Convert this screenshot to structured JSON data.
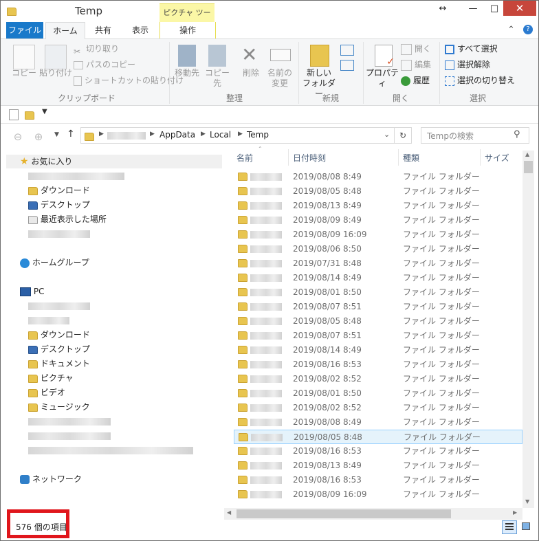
{
  "window": {
    "title": "Temp",
    "context_tab_group": "ピクチャ ツール",
    "controls": {
      "minimize": "—",
      "maximize": "□",
      "close": "✕",
      "resize": "↔"
    }
  },
  "ribbon_tabs": {
    "file": "ファイル",
    "home": "ホーム",
    "share": "共有",
    "view": "表示",
    "manage": "操作"
  },
  "ribbon": {
    "clipboard": {
      "label": "クリップボード",
      "copy": "コピー",
      "paste": "貼り付け",
      "cut": "切り取り",
      "copy_path": "パスのコピー",
      "paste_shortcut": "ショートカットの貼り付け"
    },
    "organize": {
      "label": "整理",
      "move_to": "移動先",
      "copy_to": "コピー先",
      "delete": "削除",
      "rename_1": "名前の",
      "rename_2": "変更"
    },
    "new": {
      "label": "新規",
      "new_folder_1": "新しい",
      "new_folder_2": "フォルダー"
    },
    "open": {
      "label": "開く",
      "properties": "プロパティ",
      "open": "開く",
      "edit": "編集",
      "history": "履歴"
    },
    "select": {
      "label": "選択",
      "select_all": "すべて選択",
      "select_none": "選択解除",
      "invert": "選択の切り替え"
    }
  },
  "address": {
    "path": [
      "AppData",
      "Local",
      "Temp"
    ],
    "search_placeholder": "Tempの検索"
  },
  "nav": {
    "favorites": "お気に入り",
    "downloads": "ダウンロード",
    "desktop": "デスクトップ",
    "recent": "最近表示した場所",
    "homegroup": "ホームグループ",
    "pc": "PC",
    "pc_downloads": "ダウンロード",
    "pc_desktop": "デスクトップ",
    "documents": "ドキュメント",
    "pictures": "ピクチャ",
    "videos": "ビデオ",
    "music": "ミュージック",
    "network": "ネットワーク"
  },
  "columns": {
    "name": "名前",
    "date": "日付時刻",
    "type": "種類",
    "size": "サイズ"
  },
  "files": [
    {
      "date": "2019/08/08 8:49",
      "type": "ファイル フォルダー"
    },
    {
      "date": "2019/08/05 8:48",
      "type": "ファイル フォルダー"
    },
    {
      "date": "2019/08/13 8:49",
      "type": "ファイル フォルダー"
    },
    {
      "date": "2019/08/09 8:49",
      "type": "ファイル フォルダー"
    },
    {
      "date": "2019/08/09 16:09",
      "type": "ファイル フォルダー"
    },
    {
      "date": "2019/08/06 8:50",
      "type": "ファイル フォルダー"
    },
    {
      "date": "2019/07/31 8:48",
      "type": "ファイル フォルダー"
    },
    {
      "date": "2019/08/14 8:49",
      "type": "ファイル フォルダー"
    },
    {
      "date": "2019/08/01 8:50",
      "type": "ファイル フォルダー"
    },
    {
      "date": "2019/08/07 8:51",
      "type": "ファイル フォルダー"
    },
    {
      "date": "2019/08/05 8:48",
      "type": "ファイル フォルダー"
    },
    {
      "date": "2019/08/07 8:51",
      "type": "ファイル フォルダー"
    },
    {
      "date": "2019/08/14 8:49",
      "type": "ファイル フォルダー"
    },
    {
      "date": "2019/08/16 8:53",
      "type": "ファイル フォルダー"
    },
    {
      "date": "2019/08/02 8:52",
      "type": "ファイル フォルダー"
    },
    {
      "date": "2019/08/01 8:50",
      "type": "ファイル フォルダー"
    },
    {
      "date": "2019/08/02 8:52",
      "type": "ファイル フォルダー"
    },
    {
      "date": "2019/08/08 8:49",
      "type": "ファイル フォルダー"
    },
    {
      "date": "2019/08/05 8:48",
      "type": "ファイル フォルダー",
      "selected": true
    },
    {
      "date": "2019/08/16 8:53",
      "type": "ファイル フォルダー"
    },
    {
      "date": "2019/08/13 8:49",
      "type": "ファイル フォルダー"
    },
    {
      "date": "2019/08/16 8:53",
      "type": "ファイル フォルダー"
    },
    {
      "date": "2019/08/09 16:09",
      "type": "ファイル フォルダー"
    }
  ],
  "status": {
    "item_count": "576 個の項目"
  },
  "colors": {
    "file_tab": "#1979ca",
    "context_tab": "#fbf7a6",
    "close_button": "#c7463b",
    "status_highlight": "#e0161c",
    "selection": "#e5f3fb"
  }
}
